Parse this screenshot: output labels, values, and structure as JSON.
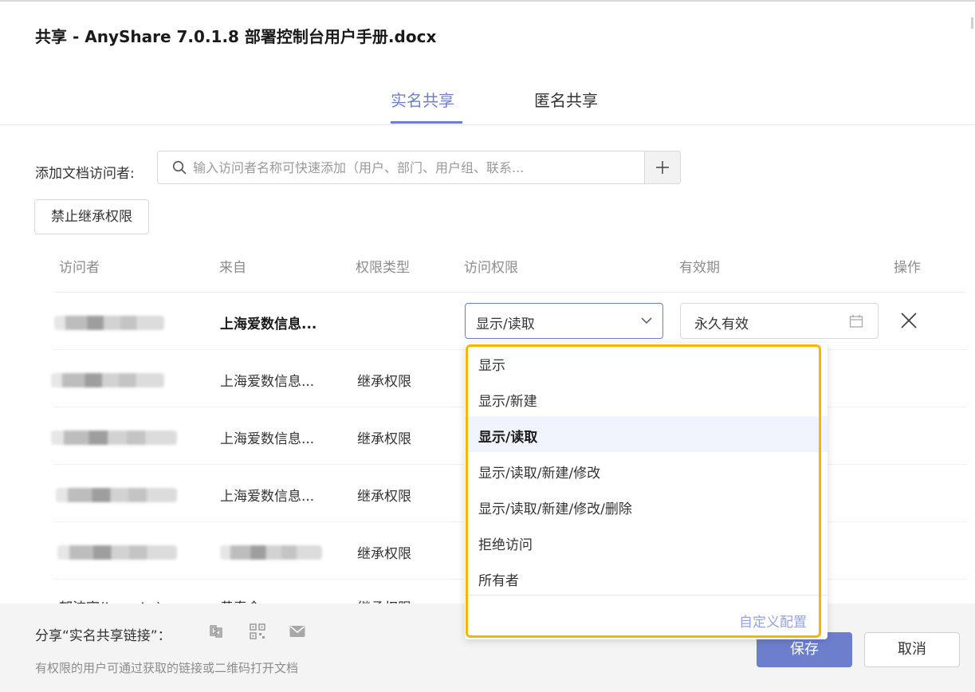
{
  "dialog": {
    "title": "共享 - AnyShare 7.0.1.8 部署控制台用户手册.docx"
  },
  "tabs": [
    {
      "label": "实名共享",
      "active": true
    },
    {
      "label": "匿名共享",
      "active": false
    }
  ],
  "add_visitor": {
    "label": "添加文档访问者:",
    "placeholder": "输入访问者名称可快速添加（用户、部门、用户组、联系..."
  },
  "inherit_button": "禁止继承权限",
  "table": {
    "headers": [
      "访问者",
      "来自",
      "权限类型",
      "访问权限",
      "有效期",
      "操作"
    ],
    "rows": [
      {
        "from": "上海爱数信息...",
        "type": ""
      },
      {
        "from": "上海爱数信息...",
        "type": "继承权限"
      },
      {
        "from": "上海爱数信息...",
        "type": "继承权限"
      },
      {
        "from": "上海爱数信息...",
        "type": "继承权限"
      },
      {
        "from": "",
        "type": "继承权限"
      }
    ],
    "cut_row": {
      "visitor": "郁波宇(Lucy Lo)",
      "from": "黄春令",
      "type": "继承权限"
    }
  },
  "permission_select": {
    "value": "显示/读取"
  },
  "expiry": {
    "value": "永久有效"
  },
  "dropdown": {
    "options": [
      "显示",
      "显示/新建",
      "显示/读取",
      "显示/读取/新建/修改",
      "显示/读取/新建/修改/删除",
      "拒绝访问",
      "所有者"
    ],
    "selected": "显示/读取",
    "custom": "自定义配置"
  },
  "footer": {
    "share_label": "分享“实名共享链接”：",
    "hint": "有权限的用户可通过获取的链接或二维码打开文档",
    "save": "保存",
    "cancel": "取消"
  },
  "colors": {
    "accent": "#6d7fcc",
    "highlight": "#f5b800"
  }
}
